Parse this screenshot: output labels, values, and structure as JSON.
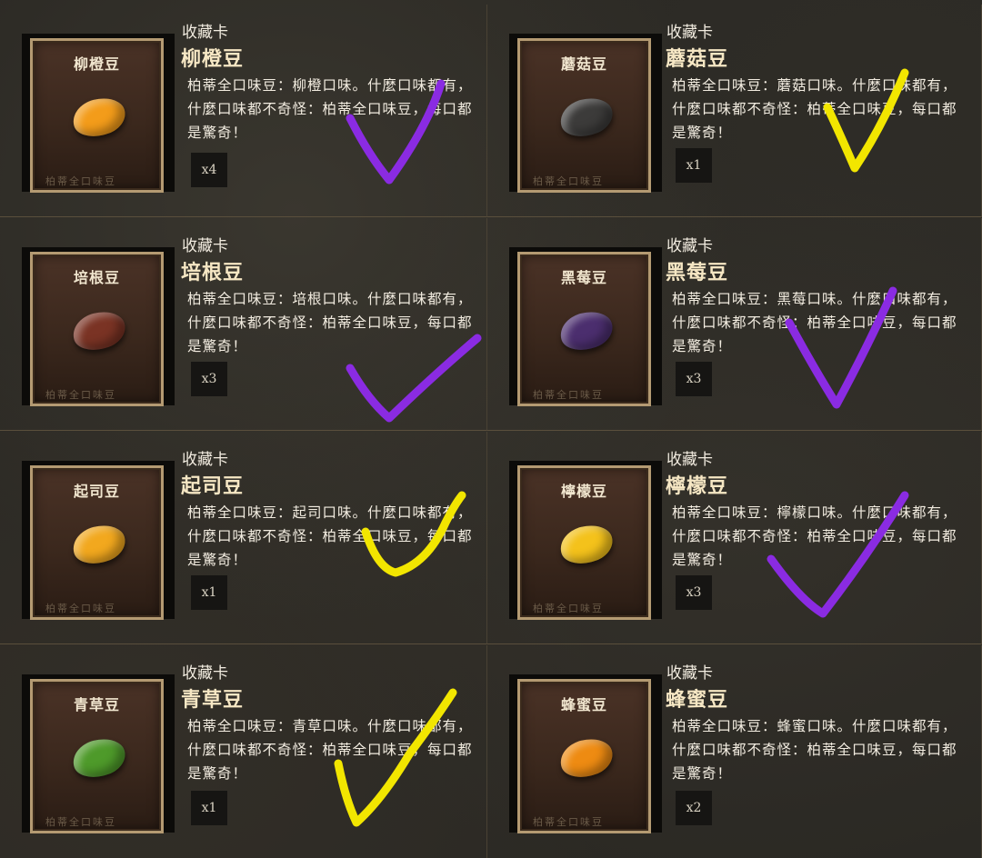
{
  "cards": [
    {
      "category": "收藏卡",
      "title": "柳橙豆",
      "card_name": "柳橙豆",
      "description": "柏蒂全口味豆：柳橙口味。什麼口味都有，什麼口味都不奇怪：柏蒂全口味豆，每口都是驚奇！",
      "quantity": "x4",
      "card_footer": "柏蒂全口味豆",
      "bean_color": "#f39c1a",
      "mark_color": "#8a2be2"
    },
    {
      "category": "收藏卡",
      "title": "蘑菇豆",
      "card_name": "蘑菇豆",
      "description": "柏蒂全口味豆：蘑菇口味。什麼口味都有，什麼口味都不奇怪：柏蒂全口味豆，每口都是驚奇！",
      "quantity": "x1",
      "card_footer": "柏蒂全口味豆",
      "bean_color": "#3c3b3a",
      "mark_color": "#f2e600"
    },
    {
      "category": "收藏卡",
      "title": "培根豆",
      "card_name": "培根豆",
      "description": "柏蒂全口味豆：培根口味。什麼口味都有，什麼口味都不奇怪：柏蒂全口味豆，每口都是驚奇！",
      "quantity": "x3",
      "card_footer": "柏蒂全口味豆",
      "bean_color": "#7a3324",
      "mark_color": "#8a2be2"
    },
    {
      "category": "收藏卡",
      "title": "黑莓豆",
      "card_name": "黑莓豆",
      "description": "柏蒂全口味豆：黑莓口味。什麼口味都有，什麼口味都不奇怪：柏蒂全口味豆，每口都是驚奇！",
      "quantity": "x3",
      "card_footer": "柏蒂全口味豆",
      "bean_color": "#4b2e6e",
      "mark_color": "#8a2be2"
    },
    {
      "category": "收藏卡",
      "title": "起司豆",
      "card_name": "起司豆",
      "description": "柏蒂全口味豆：起司口味。什麼口味都有，什麼口味都不奇怪：柏蒂全口味豆，每口都是驚奇！",
      "quantity": "x1",
      "card_footer": "柏蒂全口味豆",
      "bean_color": "#f2a81e",
      "mark_color": "#f2e600"
    },
    {
      "category": "收藏卡",
      "title": "檸檬豆",
      "card_name": "檸檬豆",
      "description": "柏蒂全口味豆：檸檬口味。什麼口味都有，什麼口味都不奇怪：柏蒂全口味豆，每口都是驚奇！",
      "quantity": "x3",
      "card_footer": "柏蒂全口味豆",
      "bean_color": "#f4c21b",
      "mark_color": "#8a2be2"
    },
    {
      "category": "收藏卡",
      "title": "青草豆",
      "card_name": "青草豆",
      "description": "柏蒂全口味豆：青草口味。什麼口味都有，什麼口味都不奇怪：柏蒂全口味豆，每口都是驚奇！",
      "quantity": "x1",
      "card_footer": "柏蒂全口味豆",
      "bean_color": "#4e9a2a",
      "mark_color": "#f2e600"
    },
    {
      "category": "收藏卡",
      "title": "蜂蜜豆",
      "card_name": "蜂蜜豆",
      "description": "柏蒂全口味豆：蜂蜜口味。什麼口味都有，什麼口味都不奇怪：柏蒂全口味豆，每口都是驚奇！",
      "quantity": "x2",
      "card_footer": "柏蒂全口味豆",
      "bean_color": "#ee8b12",
      "mark_color": null
    }
  ]
}
